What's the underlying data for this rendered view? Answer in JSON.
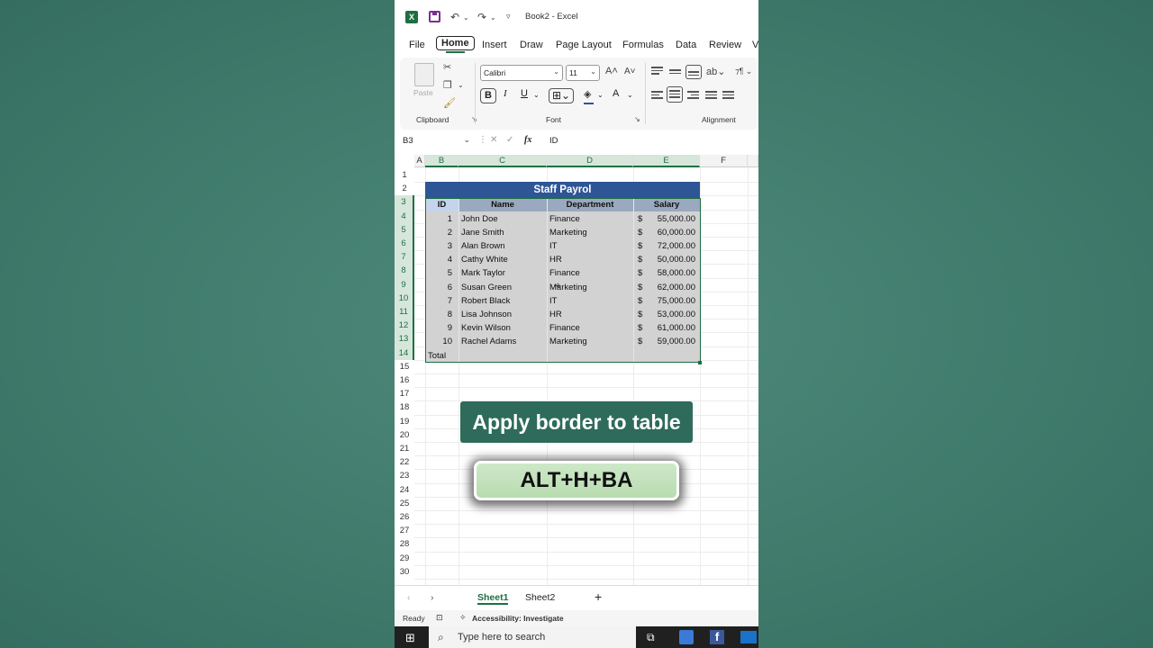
{
  "window": {
    "title": "Book2  -  Excel"
  },
  "menu": {
    "tabs": [
      "File",
      "Home",
      "Insert",
      "Draw",
      "Page Layout",
      "Formulas",
      "Data",
      "Review",
      "V"
    ],
    "active": "Home"
  },
  "ribbon": {
    "clipboard_label": "Clipboard",
    "paste_label": "Paste",
    "font_label": "Font",
    "alignment_label": "Alignment",
    "font_name": "Calibri",
    "font_size": "11",
    "bold": "B",
    "italic": "I",
    "underline": "U"
  },
  "formula_bar": {
    "name_box": "B3",
    "fx": "fx",
    "value": "ID"
  },
  "grid": {
    "columns": [
      "A",
      "B",
      "C",
      "D",
      "E",
      "F"
    ],
    "rows": [
      "1",
      "2",
      "3",
      "4",
      "5",
      "6",
      "7",
      "8",
      "9",
      "10",
      "11",
      "12",
      "13",
      "14",
      "15",
      "16",
      "17",
      "18",
      "19",
      "20",
      "21",
      "22",
      "23",
      "24",
      "25",
      "26",
      "27",
      "28",
      "29",
      "30"
    ],
    "selected_columns": [
      "B",
      "C",
      "D",
      "E"
    ]
  },
  "table": {
    "title": "Staff Payrol",
    "headers": [
      "ID",
      "Name",
      "Department",
      "Salary"
    ],
    "rows": [
      {
        "id": "1",
        "name": "John Doe",
        "dept": "Finance",
        "cur": "$",
        "salary": "55,000.00"
      },
      {
        "id": "2",
        "name": "Jane Smith",
        "dept": "Marketing",
        "cur": "$",
        "salary": "60,000.00"
      },
      {
        "id": "3",
        "name": "Alan Brown",
        "dept": "IT",
        "cur": "$",
        "salary": "72,000.00"
      },
      {
        "id": "4",
        "name": "Cathy White",
        "dept": "HR",
        "cur": "$",
        "salary": "50,000.00"
      },
      {
        "id": "5",
        "name": "Mark Taylor",
        "dept": "Finance",
        "cur": "$",
        "salary": "58,000.00"
      },
      {
        "id": "6",
        "name": "Susan Green",
        "dept": "Marketing",
        "cur": "$",
        "salary": "62,000.00"
      },
      {
        "id": "7",
        "name": "Robert Black",
        "dept": "IT",
        "cur": "$",
        "salary": "75,000.00"
      },
      {
        "id": "8",
        "name": "Lisa Johnson",
        "dept": "HR",
        "cur": "$",
        "salary": "53,000.00"
      },
      {
        "id": "9",
        "name": "Kevin Wilson",
        "dept": "Finance",
        "cur": "$",
        "salary": "61,000.00"
      },
      {
        "id": "10",
        "name": "Rachel Adams",
        "dept": "Marketing",
        "cur": "$",
        "salary": "59,000.00"
      }
    ],
    "total_label": "Total"
  },
  "overlay": {
    "banner": "Apply border to table",
    "shortcut": "ALT+H+BA"
  },
  "sheets": {
    "tabs": [
      "Sheet1",
      "Sheet2"
    ],
    "active": "Sheet1",
    "add": "+"
  },
  "status": {
    "ready": "Ready",
    "accessibility": "Accessibility: Investigate"
  },
  "taskbar": {
    "search_placeholder": "Type here to search"
  },
  "colors": {
    "excel_green": "#1d6f42",
    "title_blue": "#2e5596",
    "banner_green": "#2e6b5a",
    "shortcut_green": "#c4e4bf"
  }
}
